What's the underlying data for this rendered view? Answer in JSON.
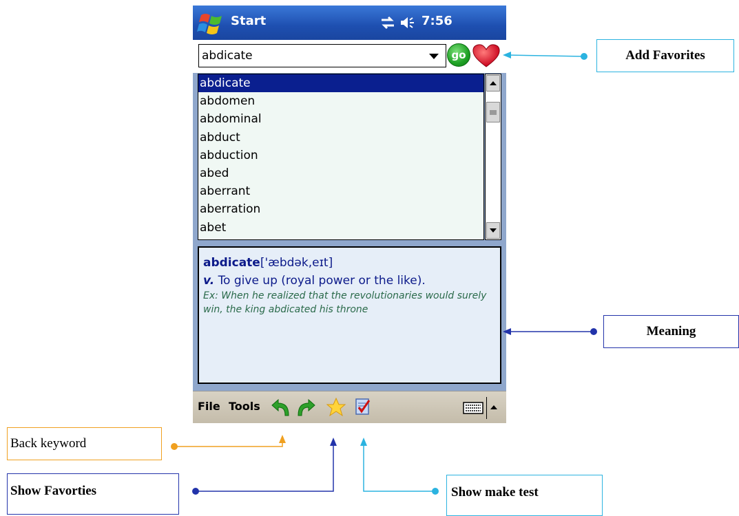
{
  "status_bar": {
    "start_label": "Start",
    "time": "7:56",
    "icons": [
      "windows-flag-icon",
      "connectivity-icon",
      "speaker-icon"
    ]
  },
  "search": {
    "value": "abdicate",
    "go_label": "go",
    "favorite_icon": "heart-icon"
  },
  "word_list": {
    "items": [
      "abdicate",
      "abdomen",
      "abdominal",
      "abduct",
      "abduction",
      "abed",
      "aberrant",
      "aberration",
      "abet"
    ],
    "selected_index": 0
  },
  "definition": {
    "headword": "abdicate",
    "pronunciation": "['æbdək,eɪt]",
    "part_of_speech": "v.",
    "meaning": "To give up (royal power or the like).",
    "example": "Ex: When he realized that the revolutionaries would surely win, the king abdicated his throne"
  },
  "menubar": {
    "file_label": "File",
    "tools_label": "Tools",
    "icons": [
      "back-arrow-icon",
      "forward-arrow-icon",
      "star-icon",
      "checklist-icon",
      "keyboard-icon"
    ]
  },
  "callouts": {
    "add_favorites": "Add Favorites",
    "meaning": "Meaning",
    "back_keyword": "Back keyword",
    "show_favorites": "Show Favorties",
    "show_make_test": "Show make test"
  },
  "colors": {
    "titlebar": "#1e4fb0",
    "selection": "#0a1f8f",
    "panel_frame": "#8fa7cc",
    "callout_cyan": "#2bb3e0",
    "callout_blue": "#2233aa",
    "callout_orange": "#f0a020"
  }
}
